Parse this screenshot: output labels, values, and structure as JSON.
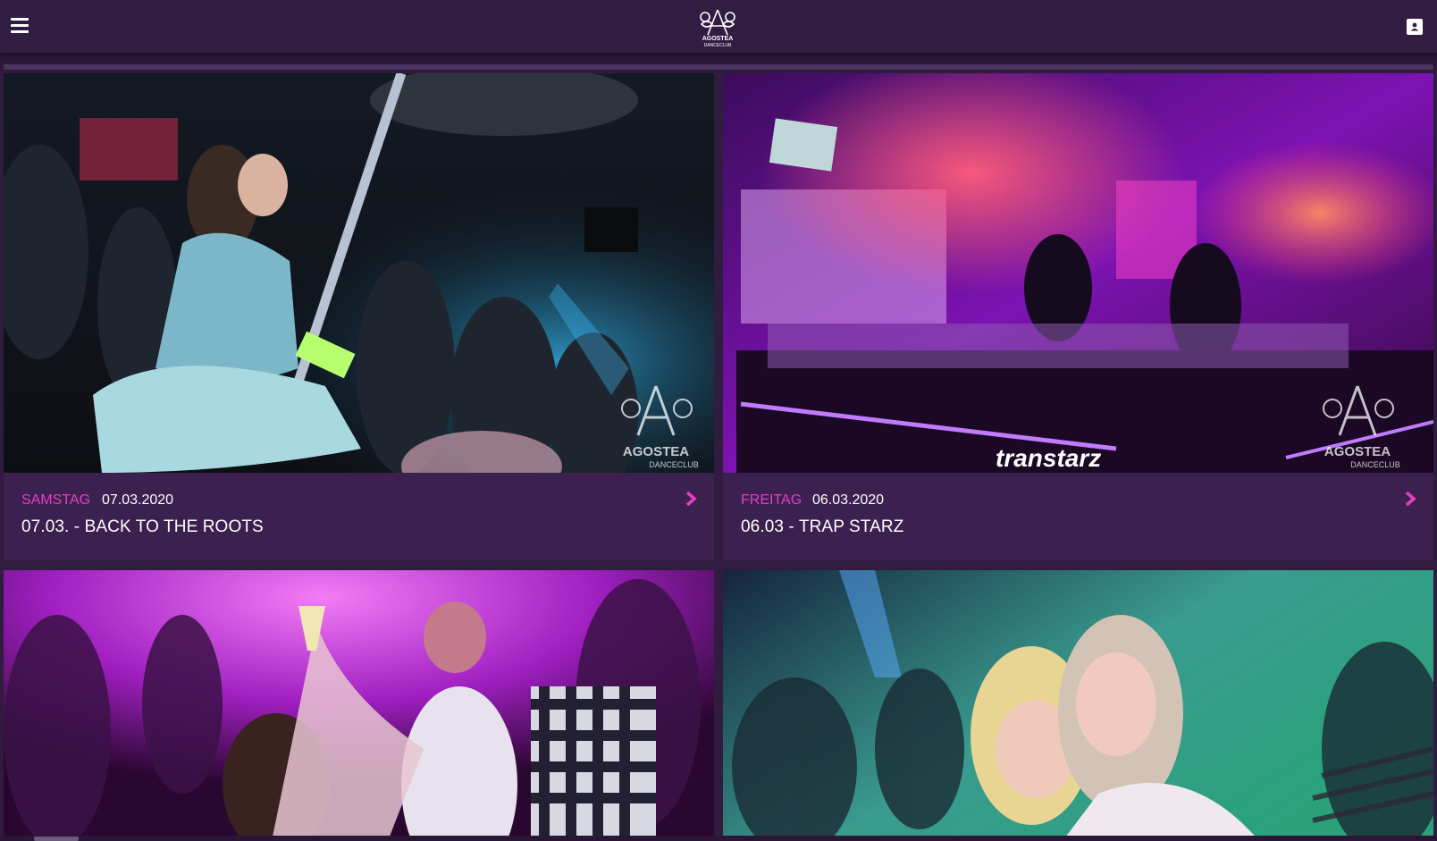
{
  "header": {
    "logo_text": "AGOSTEA",
    "logo_subtext": "DANCECLUB",
    "menu_icon": "hamburger-menu-icon",
    "user_icon": "user-icon"
  },
  "colors": {
    "accent": "#e83bc7",
    "background": "#2f1c3e",
    "card": "#3c2150"
  },
  "events": [
    {
      "day": "SAMSTAG",
      "date": "07.03.2020",
      "title": "07.03. - BACK TO THE ROOTS"
    },
    {
      "day": "FREITAG",
      "date": "06.03.2020",
      "title": "06.03 - TRAP STARZ"
    },
    {
      "day": "",
      "date": "",
      "title": ""
    },
    {
      "day": "",
      "date": "",
      "title": ""
    }
  ]
}
